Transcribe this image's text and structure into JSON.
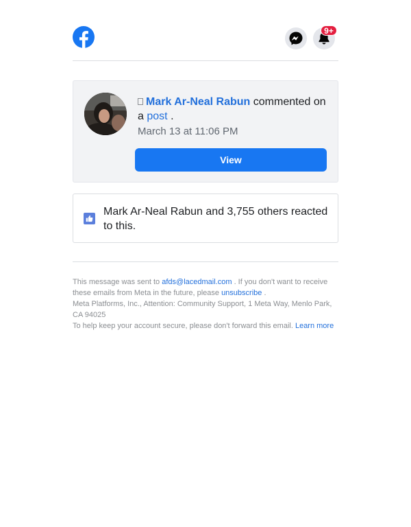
{
  "header": {
    "notification_badge": "9+"
  },
  "notification": {
    "actor_name": "Mark Ar-Neal Rabun",
    "action_text": "commented on a",
    "object_link": "post",
    "end_punct": ".",
    "timestamp": "March 13 at 11:06 PM",
    "view_button": "View"
  },
  "reactions": {
    "text": "Mark Ar-Neal Rabun and 3,755 others reacted to this."
  },
  "footer": {
    "sent_to_prefix": "This message was sent to",
    "email": "afds@lacedmail.com",
    "unsubscribe_prefix": ". If you don't want to receive these emails from Meta in the future, please",
    "unsubscribe_link": "unsubscribe",
    "unsubscribe_suffix": ".",
    "address": "Meta Platforms, Inc., Attention: Community Support, 1 Meta Way, Menlo Park, CA 94025",
    "secure_text": "To help keep your account secure, please don't forward this email.",
    "learn_more": "Learn more"
  },
  "colors": {
    "brand_blue": "#1877f2",
    "link_blue": "#216fdb",
    "badge_red": "#e41e3f",
    "card_bg": "#f2f3f5"
  },
  "icons": [
    "facebook-logo-icon",
    "messenger-icon",
    "bell-icon",
    "like-icon"
  ]
}
